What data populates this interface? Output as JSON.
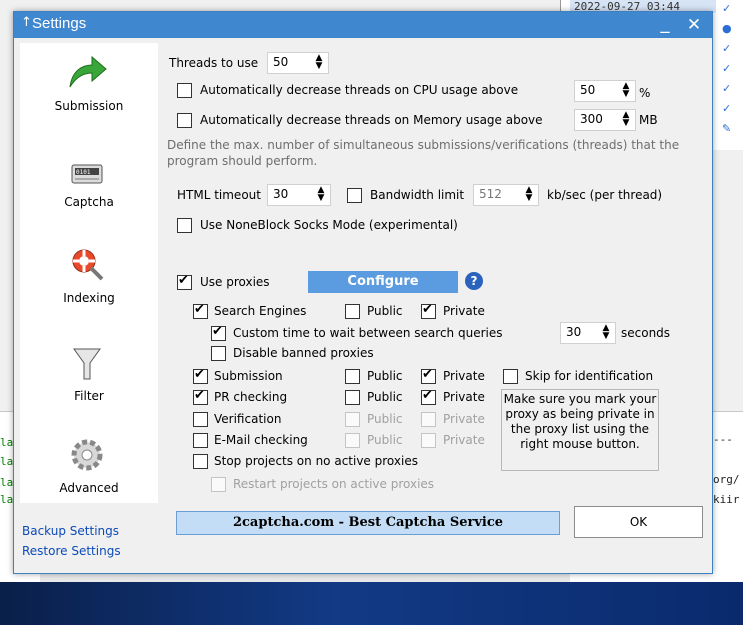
{
  "background": {
    "timestamp": "2022-09-27 03:44",
    "right_text": [
      "---",
      "org/",
      "kiir"
    ],
    "left_text": [
      "lar",
      "lar",
      "lar",
      "lar"
    ]
  },
  "window": {
    "title": "Settings",
    "minimize_glyph": "_",
    "close_glyph": "✕"
  },
  "sidebar": {
    "items": [
      {
        "label": "Submission",
        "icon": "green-arrow-icon"
      },
      {
        "label": "Captcha",
        "icon": "captcha-device-icon"
      },
      {
        "label": "Indexing",
        "icon": "lifebuoy-magnifier-icon"
      },
      {
        "label": "Filter",
        "icon": "funnel-icon"
      },
      {
        "label": "Advanced",
        "icon": "gear-icon"
      }
    ],
    "backup_link": "Backup Settings",
    "restore_link": "Restore Settings"
  },
  "threads": {
    "label": "Threads to use",
    "value": "50",
    "cpu_label": "Automatically decrease threads on CPU usage above",
    "cpu_value": "50",
    "cpu_unit": "%",
    "mem_label": "Automatically decrease threads on Memory usage above",
    "mem_value": "300",
    "mem_unit": "MB",
    "help_text_1": "Define the max. number of simultaneous submissions/verifications (threads) that the",
    "help_text_2": "program should perform."
  },
  "timeouts": {
    "html_label": "HTML timeout",
    "html_value": "30",
    "bandwidth_label": "Bandwidth limit",
    "bandwidth_value": "512",
    "bandwidth_unit": "kb/sec (per thread)",
    "noneblock_label": "Use NoneBlock Socks Mode (experimental)"
  },
  "proxies": {
    "use_label": "Use proxies",
    "configure_label": "Configure",
    "help_glyph": "?",
    "search_engines": "Search Engines",
    "public": "Public",
    "private": "Private",
    "custom_wait": "Custom time to wait between search queries",
    "wait_value": "30",
    "wait_unit": "seconds",
    "disable_banned": "Disable banned proxies",
    "submission": "Submission",
    "skip_identification": "Skip for identification",
    "pr_checking": "PR checking",
    "verification": "Verification",
    "email_checking": "E-Mail checking",
    "stop_projects": "Stop projects on no active proxies",
    "restart_projects": "Restart projects on active proxies",
    "note_lines": [
      "Make sure you mark your",
      "proxy as being private in",
      "the proxy list using the",
      "right mouse button."
    ]
  },
  "footer": {
    "banner": "2captcha.com - Best Captcha Service",
    "ok": "OK"
  }
}
